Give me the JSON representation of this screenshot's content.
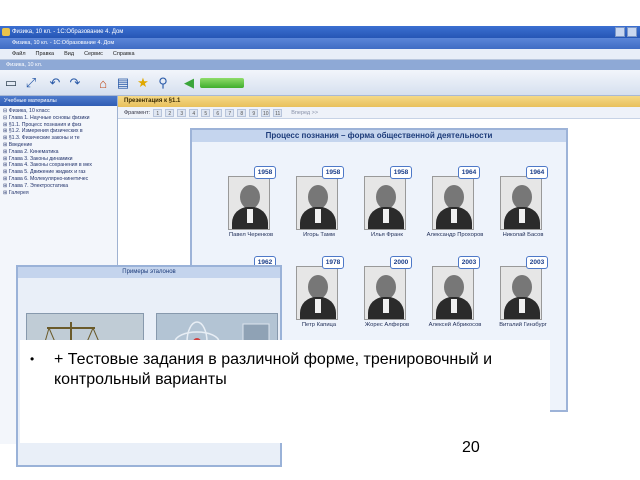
{
  "window": {
    "title": "Физика, 10 кл. - 1С:Образование 4. Дом",
    "inner_title": "Физика, 10 кл. - 1С:Образование 4. Дом",
    "doc_tab": "Физика, 10 кл."
  },
  "menu": [
    "Файл",
    "Правка",
    "Вид",
    "Сервис",
    "Справка"
  ],
  "sidebar": {
    "header": "Учебные материалы",
    "items": [
      "⊟ Физика, 10 класс",
      "  ⊟ Глава 1. Научные основы физики",
      "    ⊞ §1.1. Процесс познания и физ",
      "    ⊞ §1.2. Измерения физических в",
      "    ⊞ §1.3. Физические законы и те",
      "    ⊞ Введение",
      "  ⊞ Глава 2. Кинематика",
      "  ⊞ Глава 3. Законы динамики",
      "  ⊞ Глава 4. Законы сохранения в мех",
      "  ⊞ Глава 5. Движение жидких и газ",
      "  ⊞ Глава 6. Молекулярно-кинетичес",
      "  ⊞ Глава 7. Электростатика",
      "  ⊞ Галерея"
    ]
  },
  "main": {
    "header": "Презентация к §1.1",
    "fragment_label": "Фрагмент:",
    "pages": [
      "1",
      "2",
      "3",
      "4",
      "5",
      "6",
      "7",
      "8",
      "9",
      "10",
      "11"
    ],
    "next_label": "Вперед >>"
  },
  "slide": {
    "title": "Процесс познания – форма общественной деятельности",
    "people": [
      {
        "name": "Павел Черенков",
        "year": "1958"
      },
      {
        "name": "Игорь Тамм",
        "year": "1958"
      },
      {
        "name": "Илья Франк",
        "year": "1958"
      },
      {
        "name": "Александр Прохоров",
        "year": "1964"
      },
      {
        "name": "Николай Басов",
        "year": "1964"
      },
      {
        "name": "",
        "year": "1962"
      },
      {
        "name": "Петр Капица",
        "year": "1978"
      },
      {
        "name": "Жорес Алферов",
        "year": "2000"
      },
      {
        "name": "Алексей Абрикосов",
        "year": "2003"
      },
      {
        "name": "Виталий Гинзбург",
        "year": "2003"
      }
    ]
  },
  "etalon": {
    "title": "Примеры эталонов"
  },
  "callout": {
    "bullet": "•",
    "text": "+ Тестовые задания в различной форме, тренировочный и контрольный варианты"
  },
  "page_number": "20"
}
